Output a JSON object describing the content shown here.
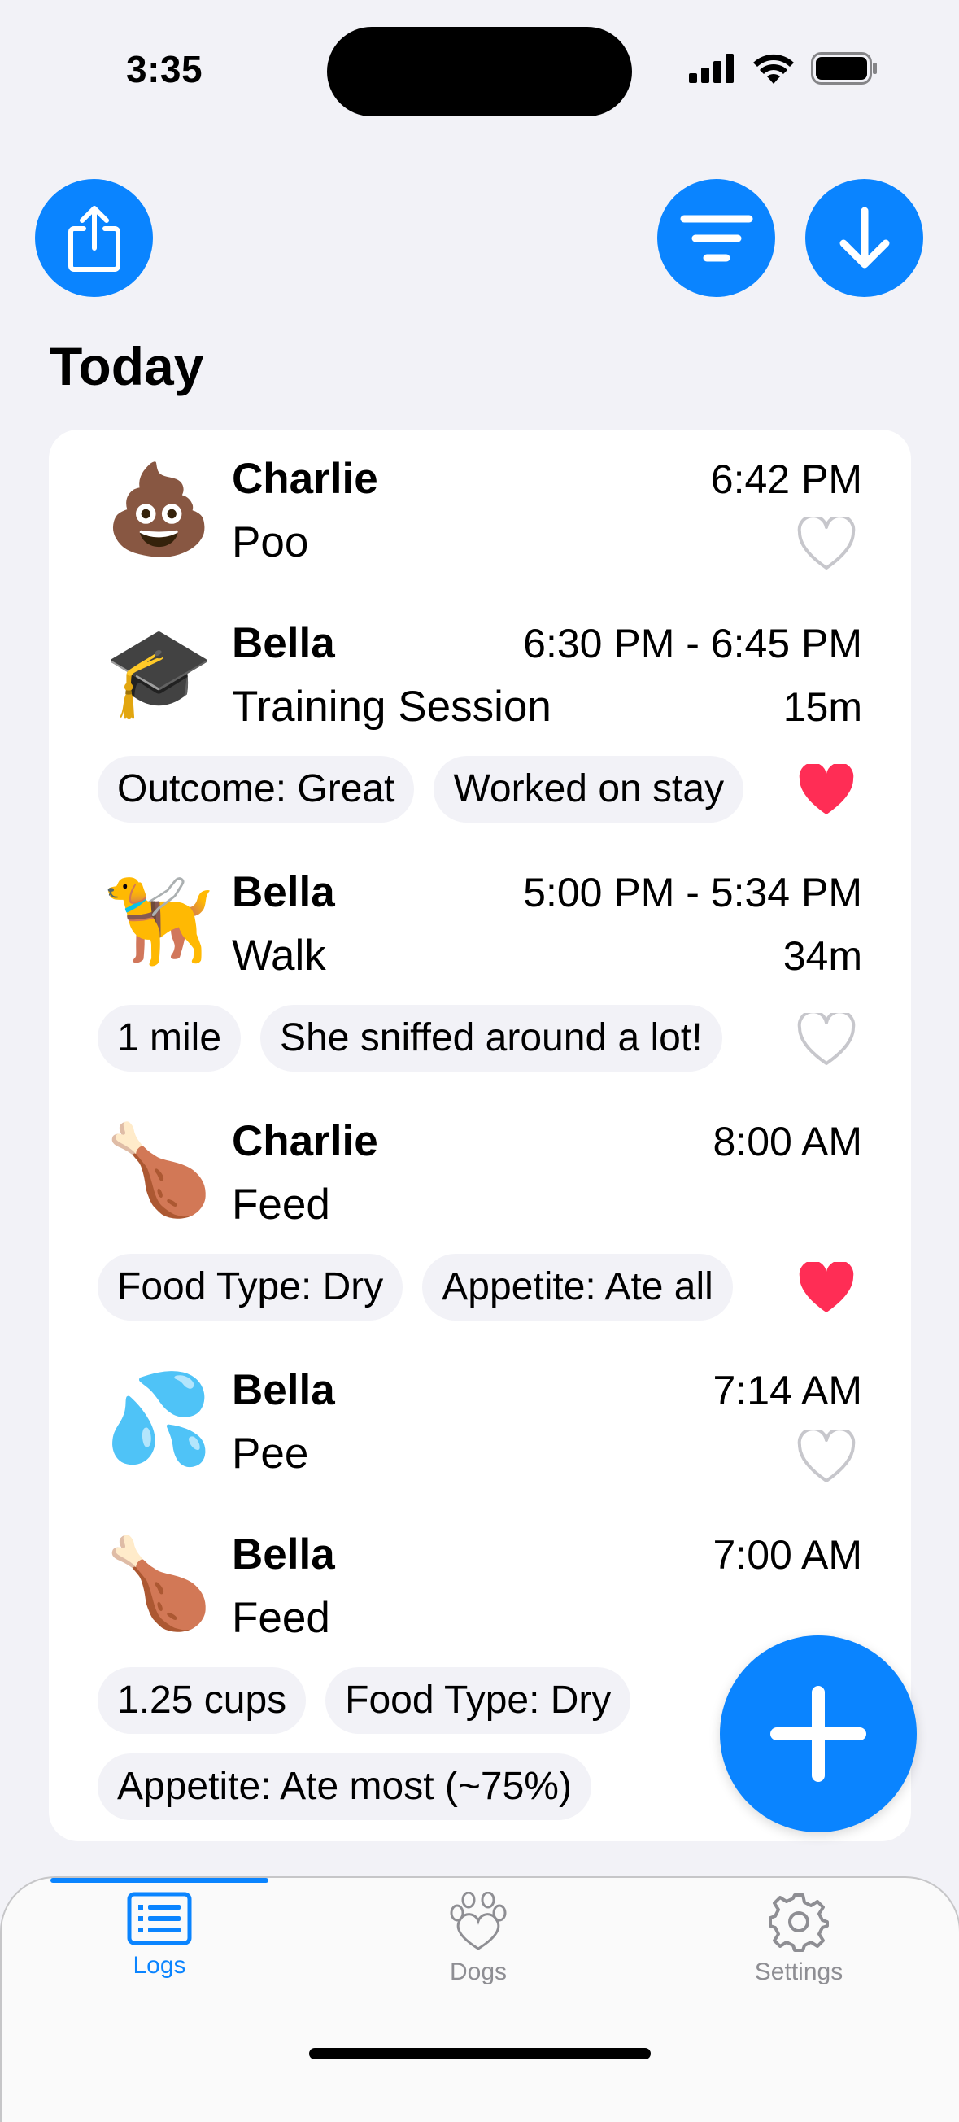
{
  "status_bar": {
    "time": "3:35"
  },
  "header": {
    "section_title": "Today"
  },
  "entries": [
    {
      "emoji": "💩",
      "emoji_name": "poo-emoji-icon",
      "dog": "Charlie",
      "activity": "Poo",
      "time": "6:42 PM",
      "duration": "",
      "favorite": false,
      "chips": []
    },
    {
      "emoji": "🎓",
      "emoji_name": "graduation-cap-icon",
      "dog": "Bella",
      "activity": "Training Session",
      "time": "6:30 PM - 6:45 PM",
      "duration": "15m",
      "favorite": true,
      "chips": [
        "Outcome: Great",
        "Worked on stay"
      ]
    },
    {
      "emoji": "🦮",
      "emoji_name": "guide-dog-icon",
      "dog": "Bella",
      "activity": "Walk",
      "time": "5:00 PM - 5:34 PM",
      "duration": "34m",
      "favorite": false,
      "chips": [
        "1 mile",
        "She sniffed around a lot!"
      ]
    },
    {
      "emoji": "🍗",
      "emoji_name": "poultry-leg-icon",
      "dog": "Charlie",
      "activity": "Feed",
      "time": "8:00 AM",
      "duration": "",
      "favorite": true,
      "chips": [
        "Food Type: Dry",
        "Appetite: Ate all"
      ]
    },
    {
      "emoji": "💦",
      "emoji_name": "sweat-droplets-icon",
      "dog": "Bella",
      "activity": "Pee",
      "time": "7:14 AM",
      "duration": "",
      "favorite": false,
      "chips": []
    },
    {
      "emoji": "🍗",
      "emoji_name": "poultry-leg-icon",
      "dog": "Bella",
      "activity": "Feed",
      "time": "7:00 AM",
      "duration": "",
      "favorite": null,
      "chips": [
        "1.25 cups",
        "Food Type: Dry"
      ],
      "chips_row2": [
        "Appetite: Ate most (~75%)"
      ]
    }
  ],
  "tabs": [
    {
      "label": "Logs",
      "icon": "list-icon",
      "active": true
    },
    {
      "label": "Dogs",
      "icon": "paw-heart-icon",
      "active": false
    },
    {
      "label": "Settings",
      "icon": "gear-icon",
      "active": false
    }
  ],
  "colors": {
    "accent": "#0a84ff",
    "heart": "#ff2d55",
    "heart_outline": "#c7c7cc",
    "background": "#f2f2f7"
  }
}
